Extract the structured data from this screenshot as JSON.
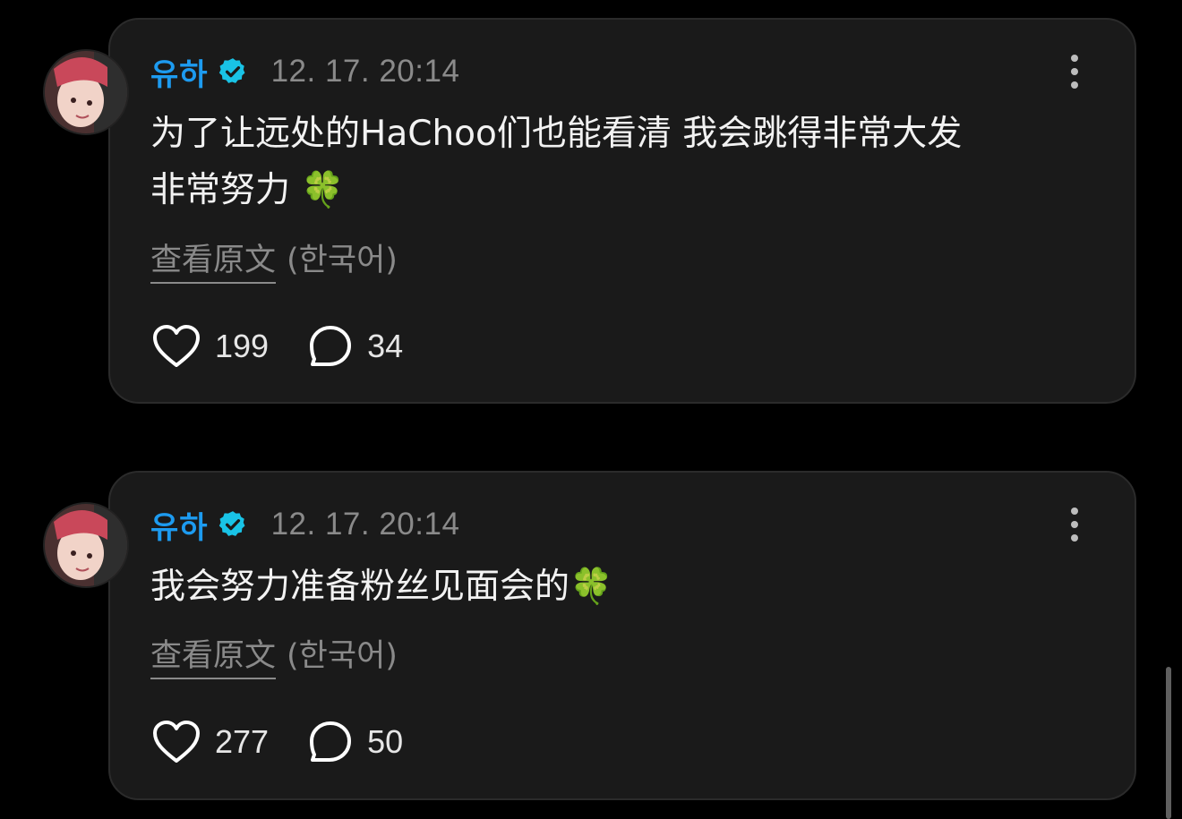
{
  "posts": [
    {
      "username": "유하",
      "timestamp": "12. 17. 20:14",
      "text_line1": "为了让远处的HaChoo们也能看清 我会跳得非常大发",
      "text_line2": "非常努力",
      "emoji": "🍀",
      "view_original_label": "查看原文",
      "lang_label": "(한국어)",
      "likes": "199",
      "replies": "34"
    },
    {
      "username": "유하",
      "timestamp": "12. 17. 20:14",
      "text_line1": "我会努力准备粉丝见面会的",
      "emoji": "🍀",
      "view_original_label": "查看原文",
      "lang_label": "(한국어)",
      "likes": "277",
      "replies": "50"
    }
  ],
  "icons": {
    "verified": "verified-badge-icon",
    "more": "more-vertical-icon",
    "like": "heart-icon",
    "reply": "comment-bubble-icon"
  },
  "colors": {
    "background": "#000000",
    "card": "#1a1a1a",
    "username": "#1d9bf0",
    "verified": "#19c3e6",
    "muted": "#8a8a8a",
    "text": "#f2f2f2"
  }
}
